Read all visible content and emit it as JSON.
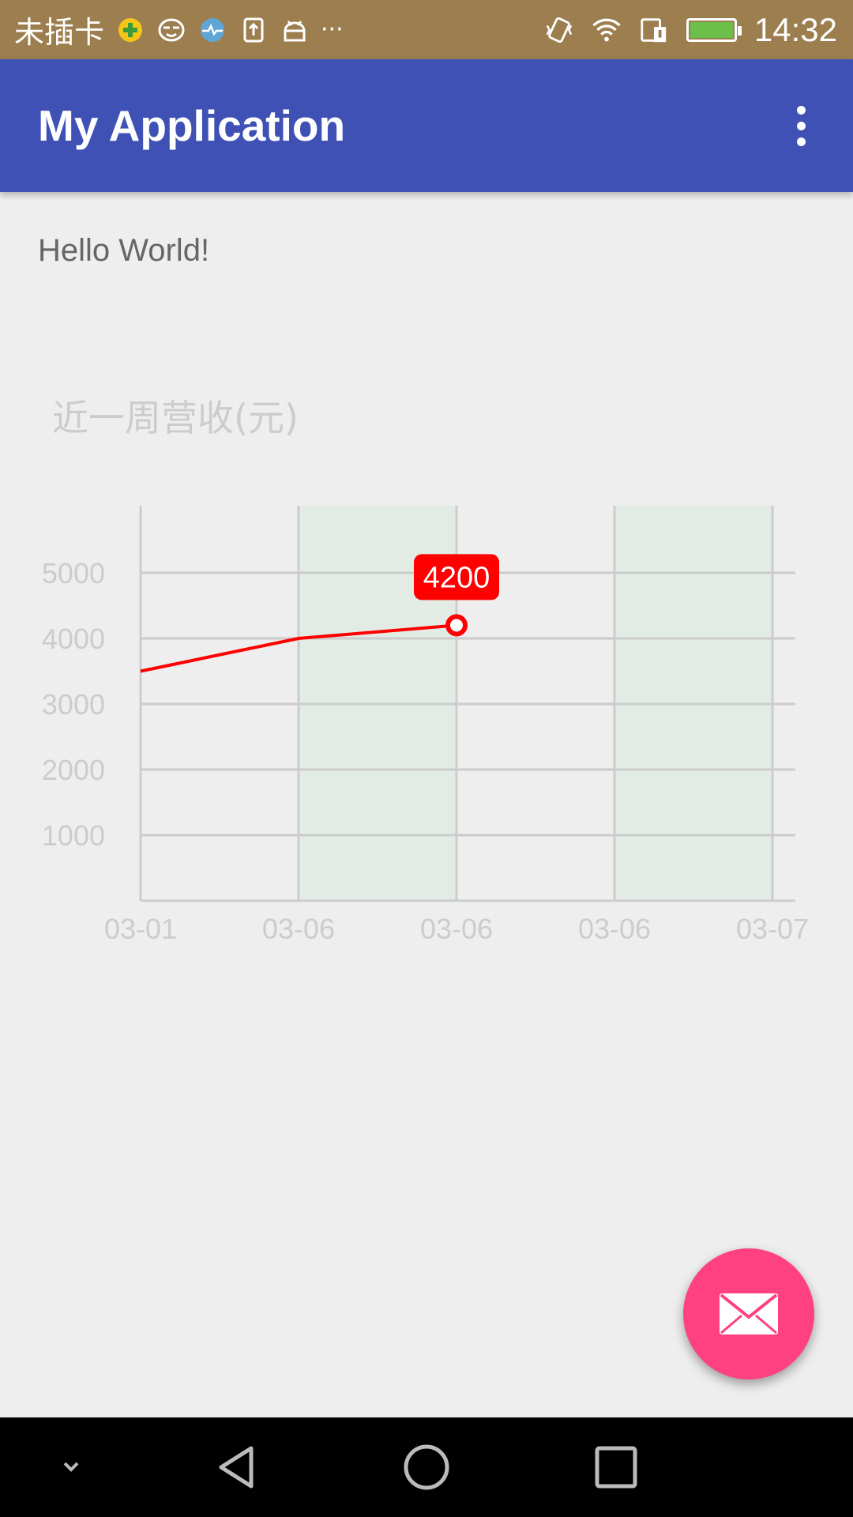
{
  "status_bar": {
    "carrier": "未插卡",
    "more": "···",
    "time": "14:32"
  },
  "app_bar": {
    "title": "My Application"
  },
  "content": {
    "hello_text": "Hello World!"
  },
  "chart_data": {
    "type": "line",
    "title": "近一周营收(元)",
    "categories": [
      "03-01",
      "03-06",
      "03-06",
      "03-06",
      "03-07"
    ],
    "y_ticks": [
      5000,
      4000,
      3000,
      2000,
      1000
    ],
    "series": [
      {
        "values": [
          3500,
          4000,
          4200
        ],
        "color": "#ff0000"
      }
    ],
    "highlight": {
      "index": 2,
      "value": 4200,
      "label": "4200"
    },
    "shaded_columns": [
      1,
      3
    ],
    "ylim": [
      0,
      6000
    ],
    "grid": true
  },
  "colors": {
    "status_bar": "#9c7e4f",
    "app_bar": "#3f51b5",
    "fab": "#ff4081",
    "line": "#ff0000",
    "shade": "#e2ece4"
  },
  "icons": {
    "fab": "mail-icon",
    "overflow": "more-vert-icon"
  }
}
